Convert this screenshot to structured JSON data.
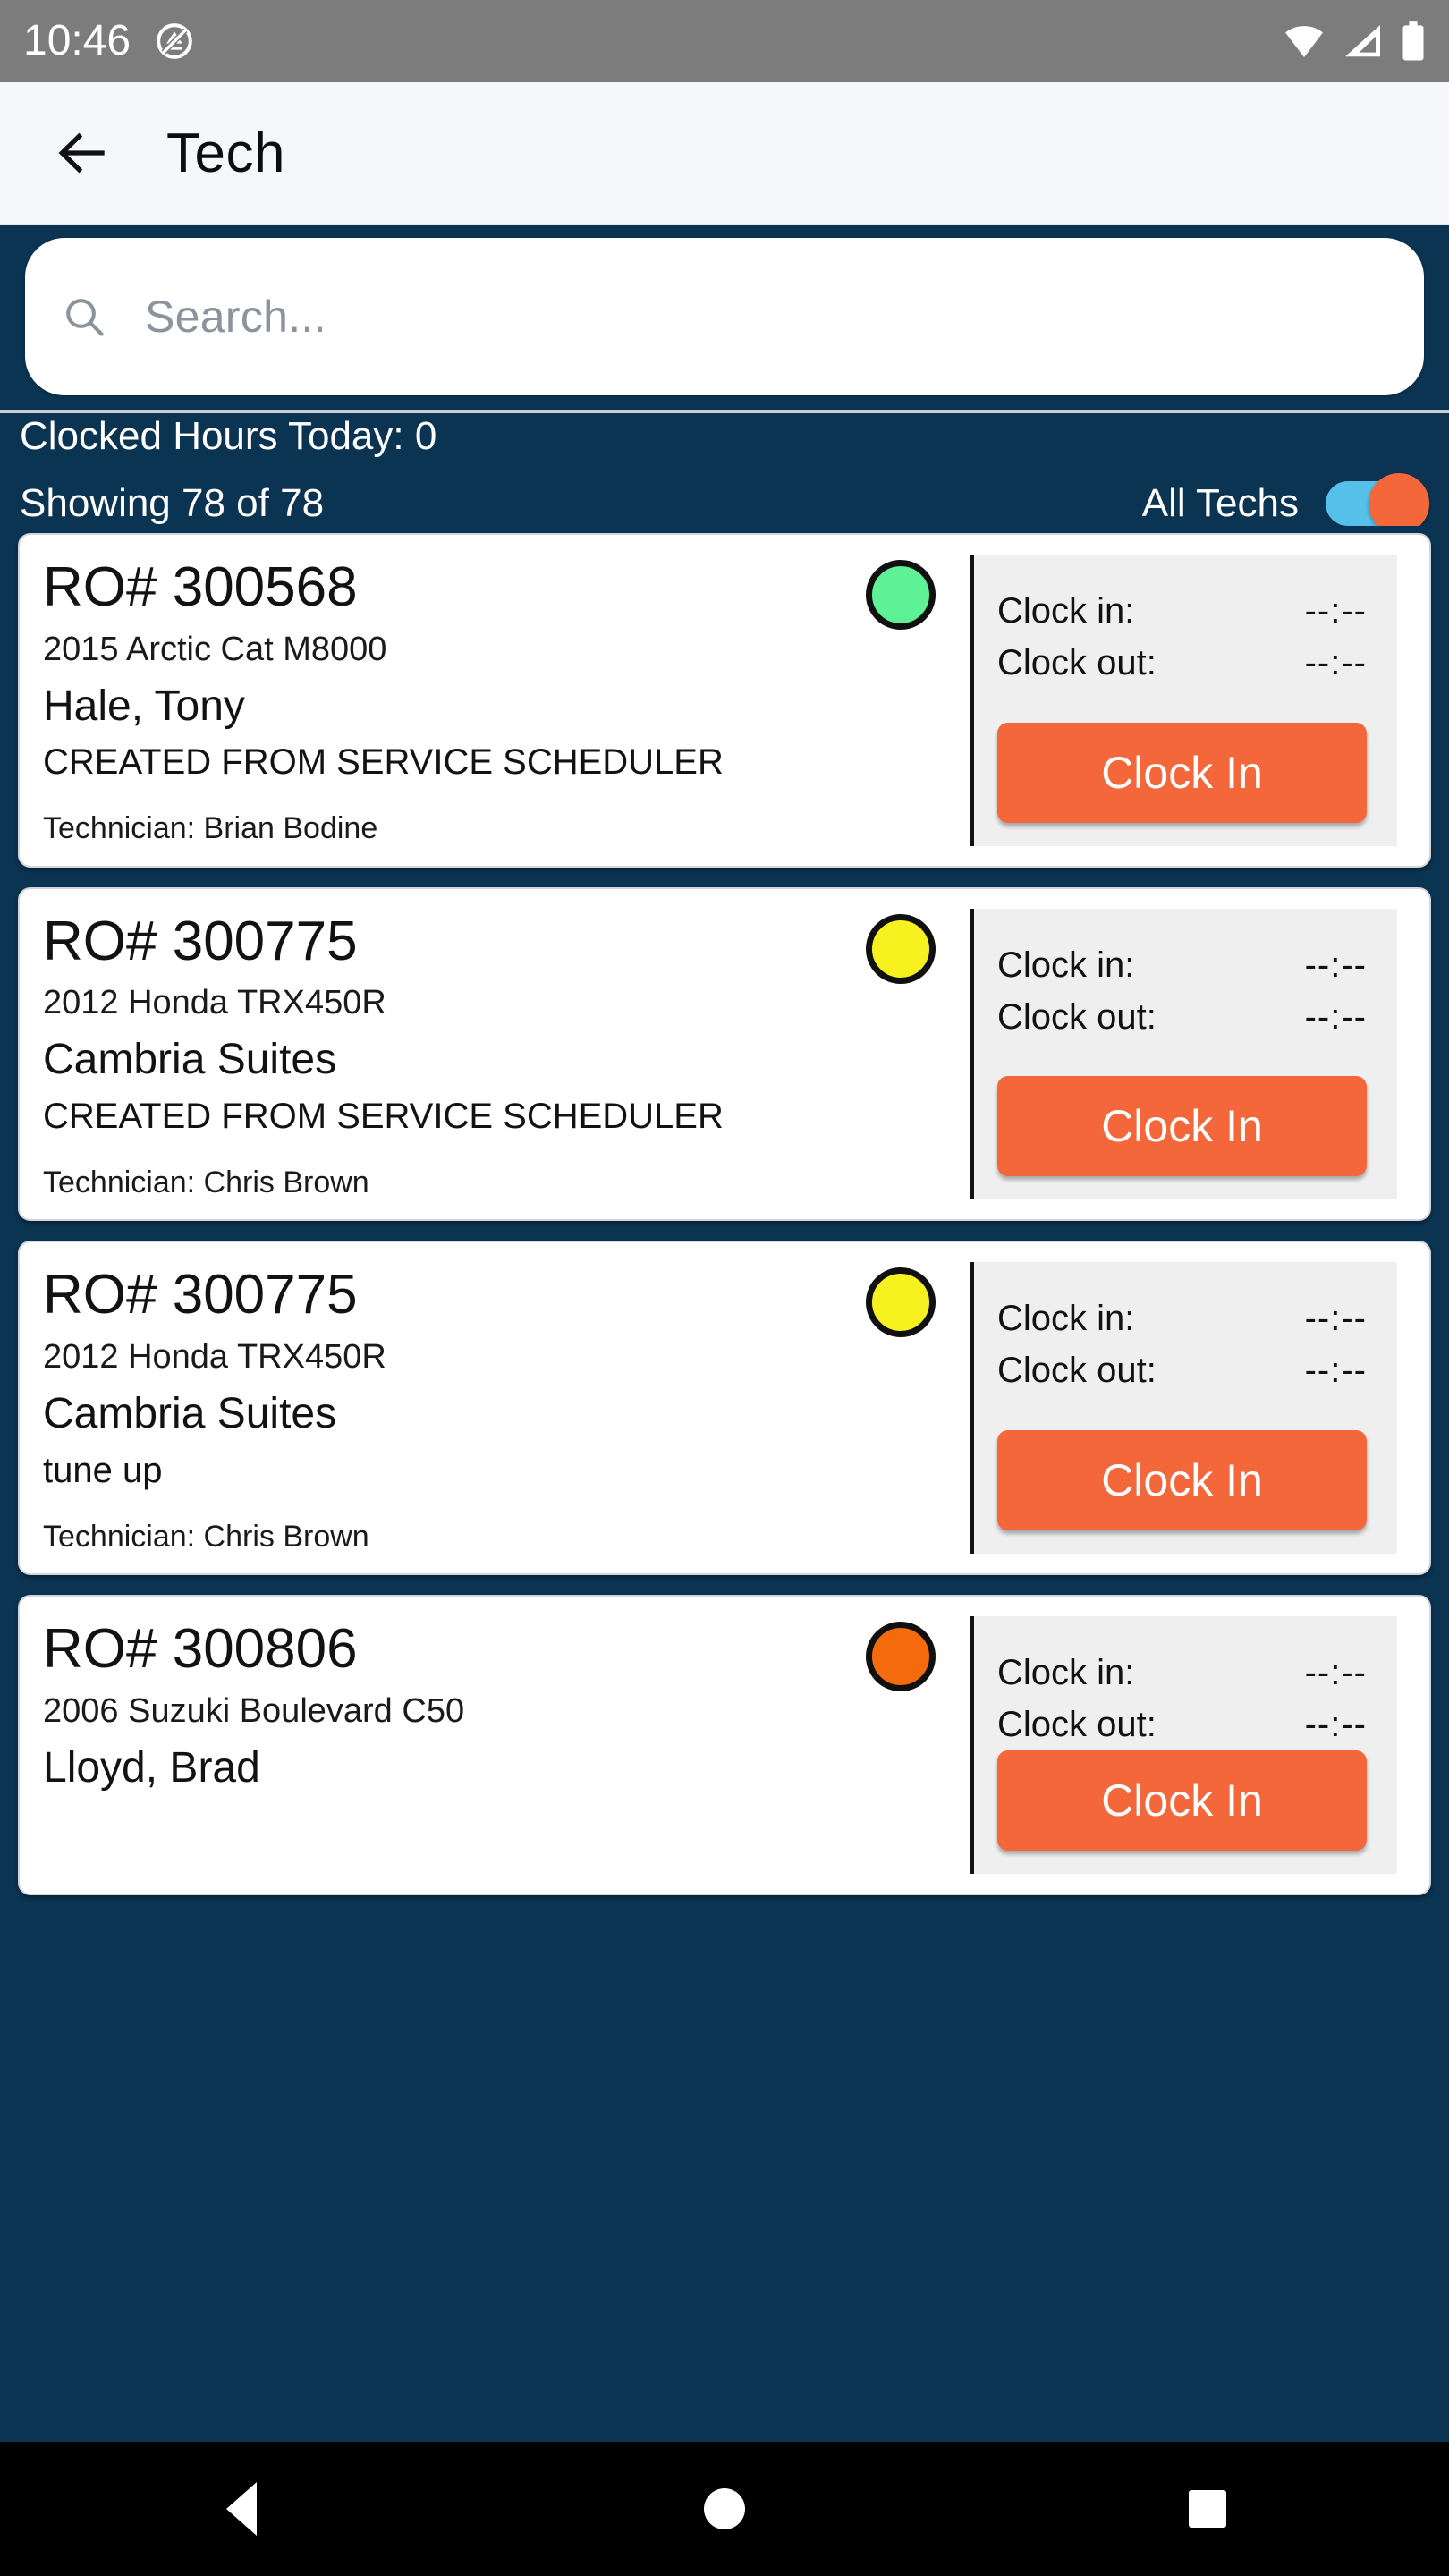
{
  "status_bar": {
    "time": "10:46",
    "icons": [
      "dnd-icon",
      "wifi-icon",
      "cellular-icon",
      "battery-icon"
    ]
  },
  "app_bar": {
    "back_icon": "arrow-left-icon",
    "title": "Tech"
  },
  "search": {
    "placeholder": "Search...",
    "value": "",
    "icon": "search-icon"
  },
  "info": {
    "clocked_hours_label": "Clocked Hours Today: 0",
    "showing_label": "Showing 78 of 78",
    "all_techs_label": "All Techs",
    "all_techs_on": true
  },
  "colors": {
    "navy": "#0b3453",
    "orange": "#f4673a",
    "toggle_track": "#56c0e8",
    "status_green": "#5ef196",
    "status_yellow": "#f7f11f",
    "status_orange": "#f56a0c",
    "panel_gray": "#efefef",
    "appbar_bg": "#f5f7fb"
  },
  "cards": [
    {
      "ro_number": "RO# 300568",
      "vehicle": "2015 Arctic Cat M8000",
      "customer": "Hale, Tony",
      "note": "CREATED FROM SERVICE SCHEDULER",
      "technician": "Technician: Brian Bodine",
      "status_color": "#5ef196",
      "status_name": "status-dot-green",
      "clock_in_label": "Clock in:",
      "clock_in_value": "--:--",
      "clock_out_label": "Clock out:",
      "clock_out_value": "--:--",
      "button_label": "Clock In"
    },
    {
      "ro_number": "RO# 300775",
      "vehicle": "2012 Honda TRX450R",
      "customer": "Cambria Suites",
      "note": "CREATED FROM SERVICE SCHEDULER",
      "technician": "Technician: Chris Brown",
      "status_color": "#f7f11f",
      "status_name": "status-dot-yellow",
      "clock_in_label": "Clock in:",
      "clock_in_value": "--:--",
      "clock_out_label": "Clock out:",
      "clock_out_value": "--:--",
      "button_label": "Clock In"
    },
    {
      "ro_number": "RO# 300775",
      "vehicle": "2012 Honda TRX450R",
      "customer": "Cambria Suites",
      "note": "tune up",
      "technician": "Technician: Chris Brown",
      "status_color": "#f7f11f",
      "status_name": "status-dot-yellow",
      "clock_in_label": "Clock in:",
      "clock_in_value": "--:--",
      "clock_out_label": "Clock out:",
      "clock_out_value": "--:--",
      "button_label": "Clock In"
    },
    {
      "ro_number": "RO# 300806",
      "vehicle": "2006 Suzuki Boulevard C50",
      "customer": "Lloyd, Brad",
      "note": "",
      "technician": "",
      "status_color": "#f56a0c",
      "status_name": "status-dot-orange",
      "clock_in_label": "Clock in:",
      "clock_in_value": "--:--",
      "clock_out_label": "Clock out:",
      "clock_out_value": "--:--",
      "button_label": "Clock In"
    }
  ],
  "nav_bar": {
    "back": "nav-back-icon",
    "home": "nav-home-icon",
    "recents": "nav-recents-icon"
  }
}
